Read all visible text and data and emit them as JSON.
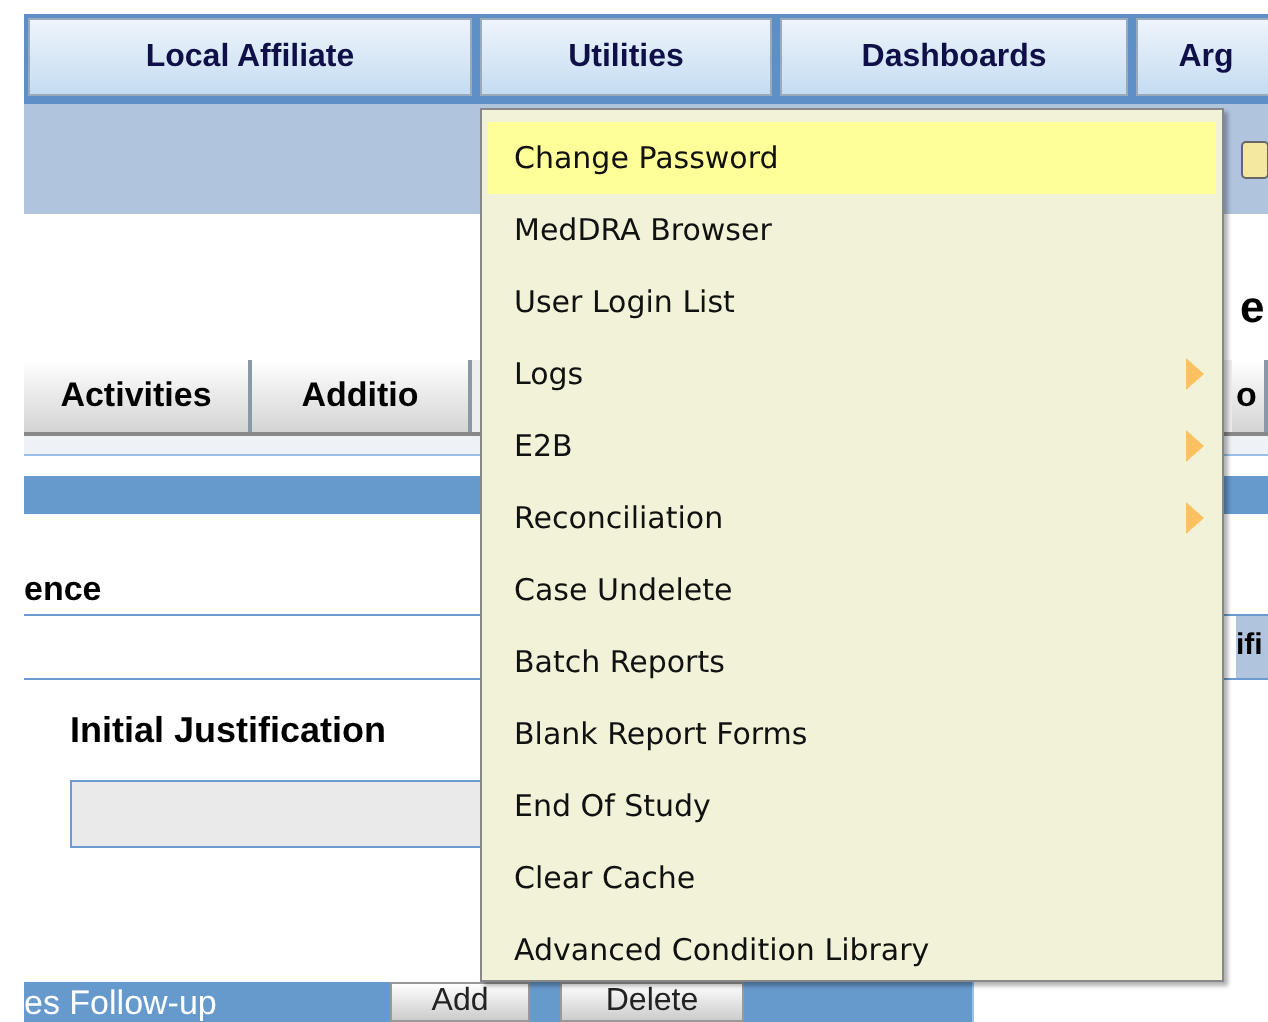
{
  "top_tabs": [
    {
      "label": "Local Affiliate"
    },
    {
      "label": "Utilities"
    },
    {
      "label": "Dashboards"
    },
    {
      "label": "Arg"
    }
  ],
  "heading_fragment": "e",
  "section_tabs": [
    {
      "label": "Activities"
    },
    {
      "label": "Additio"
    },
    {
      "label": "o"
    }
  ],
  "section_label": "ence",
  "side_label": "ifi",
  "justification": {
    "label": "Initial Justification"
  },
  "followup": {
    "label": "es Follow-up",
    "buttons": [
      "Add",
      "Delete"
    ]
  },
  "menu": {
    "items": [
      {
        "label": "Change Password",
        "selected": true,
        "submenu": false
      },
      {
        "label": "MedDRA Browser",
        "selected": false,
        "submenu": false
      },
      {
        "label": "User Login List",
        "selected": false,
        "submenu": false
      },
      {
        "label": "Logs",
        "selected": false,
        "submenu": true
      },
      {
        "label": "E2B",
        "selected": false,
        "submenu": true
      },
      {
        "label": "Reconciliation",
        "selected": false,
        "submenu": true
      },
      {
        "label": "Case Undelete",
        "selected": false,
        "submenu": false
      },
      {
        "label": "Batch Reports",
        "selected": false,
        "submenu": false
      },
      {
        "label": "Blank Report Forms",
        "selected": false,
        "submenu": false
      },
      {
        "label": "End Of Study",
        "selected": false,
        "submenu": false
      },
      {
        "label": "Clear Cache",
        "selected": false,
        "submenu": false
      },
      {
        "label": "Advanced Condition Library",
        "selected": false,
        "submenu": false
      }
    ]
  }
}
